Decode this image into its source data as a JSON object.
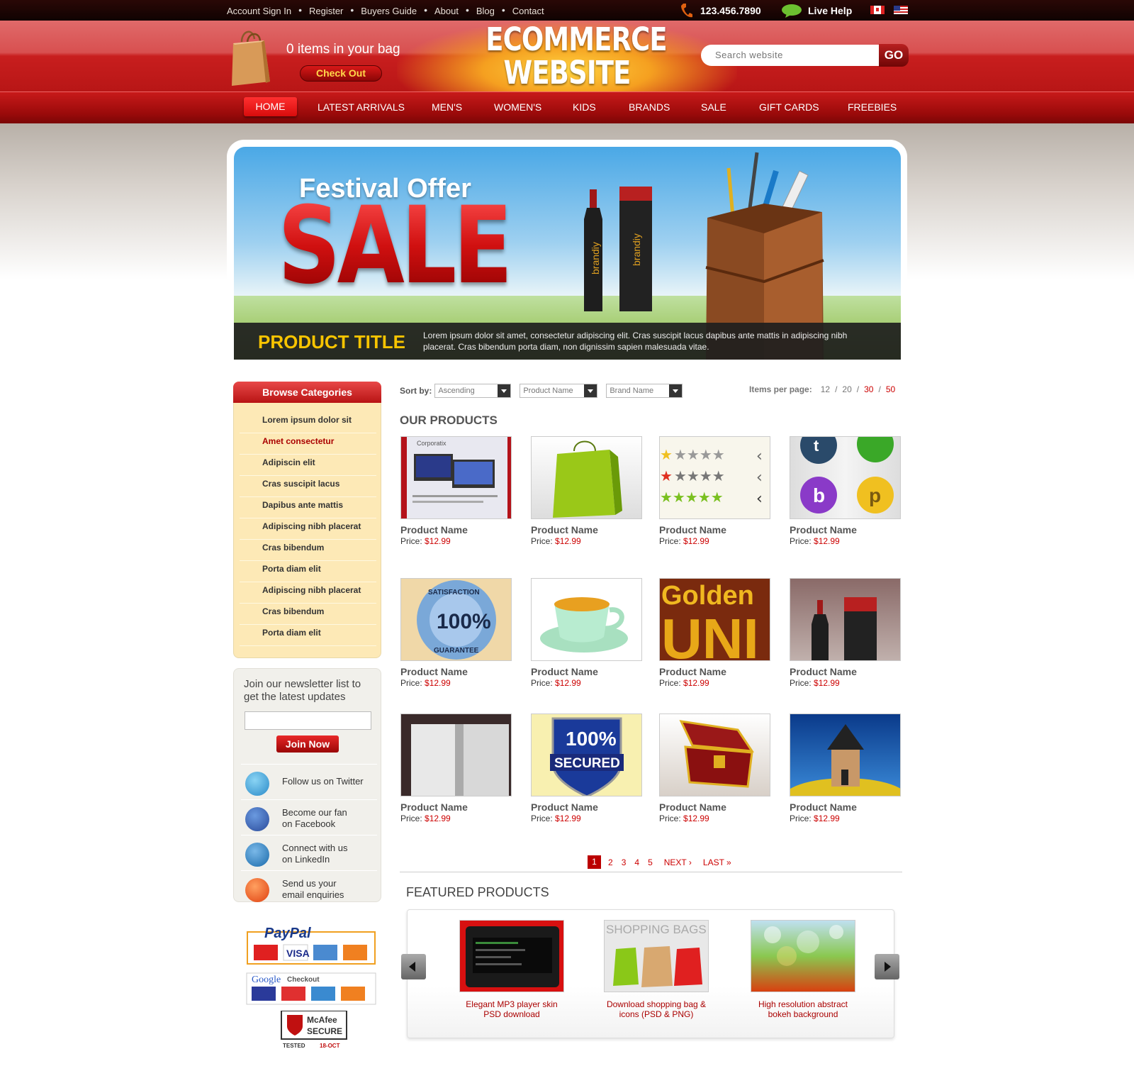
{
  "topbar": {
    "links": [
      "Account Sign In",
      "Register",
      "Buyers Guide",
      "About",
      "Blog",
      "Contact"
    ],
    "phone": "123.456.7890",
    "live_help": "Live Help"
  },
  "header": {
    "bag_count": "0 items in your bag",
    "checkout": "Check Out",
    "logo_line1": "ECOMMERCE",
    "logo_line2": "WEBSITE",
    "search_placeholder": "Search website",
    "search_go": "GO"
  },
  "nav": {
    "items": [
      "HOME",
      "LATEST ARRIVALS",
      "MEN'S",
      "WOMEN'S",
      "KIDS",
      "BRANDS",
      "SALE",
      "GIFT CARDS",
      "FREEBIES"
    ]
  },
  "banner": {
    "festival": "Festival Offer",
    "sale": "SALE",
    "product_title": "PRODUCT TITLE",
    "description": "Lorem ipsum dolor sit amet, consectetur adipiscing elit. Cras suscipit lacus dapibus ante mattis in adipiscing nibh placerat. Cras bibendum porta diam, non dignissim sapien malesuada vitae.",
    "bottle_label": "brandiy"
  },
  "sidebar": {
    "categories_title": "Browse Categories",
    "categories": [
      "Lorem ipsum dolor sit",
      "Amet consectetur",
      "Adipiscin elit",
      "Cras suscipit lacus",
      "Dapibus ante mattis",
      "Adipiscing nibh placerat",
      "Cras bibendum",
      "Porta diam elit",
      "Adipiscing nibh placerat",
      "Cras bibendum",
      "Porta diam elit"
    ],
    "newsletter_title": "Join our newsletter list to get the latest updates",
    "join_button": "Join Now",
    "social": [
      {
        "line1": "Follow us on Twitter",
        "line2": ""
      },
      {
        "line1": "Become our fan",
        "line2": "on Facebook"
      },
      {
        "line1": "Connect with us",
        "line2": "on LinkedIn"
      },
      {
        "line1": "Send us your",
        "line2": "email enquiries"
      }
    ],
    "payment": {
      "paypal": "PayPal",
      "google_checkout": "Checkout",
      "mcafee": "McAfee",
      "mcafee_secure": "SECURE",
      "mcafee_tested": "TESTED",
      "mcafee_date": "18-OCT"
    }
  },
  "main": {
    "sort_label": "Sort by:",
    "sort_options": [
      "Ascending",
      "Product Name",
      "Brand Name"
    ],
    "items_per_page_label": "Items per page:",
    "items_per_page": [
      "12",
      "20",
      "30",
      "50"
    ],
    "products_title": "OUR PRODUCTS",
    "products": [
      {
        "name": "Product Name",
        "price_label": "Price:",
        "price": "$12.99"
      },
      {
        "name": "Product Name",
        "price_label": "Price:",
        "price": "$12.99"
      },
      {
        "name": "Product Name",
        "price_label": "Price:",
        "price": "$12.99"
      },
      {
        "name": "Product Name",
        "price_label": "Price:",
        "price": "$12.99"
      },
      {
        "name": "Product Name",
        "price_label": "Price:",
        "price": "$12.99"
      },
      {
        "name": "Product Name",
        "price_label": "Price:",
        "price": "$12.99"
      },
      {
        "name": "Product Name",
        "price_label": "Price:",
        "price": "$12.99"
      },
      {
        "name": "Product Name",
        "price_label": "Price:",
        "price": "$12.99"
      },
      {
        "name": "Product Name",
        "price_label": "Price:",
        "price": "$12.99"
      },
      {
        "name": "Product Name",
        "price_label": "Price:",
        "price": "$12.99"
      },
      {
        "name": "Product Name",
        "price_label": "Price:",
        "price": "$12.99"
      },
      {
        "name": "Product Name",
        "price_label": "Price:",
        "price": "$12.99"
      }
    ],
    "image_text": {
      "golden": "Golden",
      "unl": "UNI",
      "satisfaction": "SATISFACTION",
      "guarantee": "GUARANTEE",
      "pct": "100%",
      "secured": "SECURED",
      "corporatix": "Corporatix"
    },
    "pagination": {
      "pages": [
        "1",
        "2",
        "3",
        "4",
        "5"
      ],
      "current": "1",
      "next": "NEXT",
      "last": "LAST"
    },
    "featured_title": "FEATURED PRODUCTS",
    "featured": [
      {
        "line1": "Elegant MP3 player skin",
        "line2": "PSD download"
      },
      {
        "line1": "Download shopping bag &",
        "line2": "icons (PSD & PNG)"
      },
      {
        "line1": "High resolution abstract",
        "line2": "bokeh background"
      }
    ],
    "featured_bags_text": "SHOPPING BAGS"
  },
  "colors": {
    "brand_red": "#c81e1e",
    "accent_yellow": "#f8c400",
    "link_red": "#cc0000"
  }
}
